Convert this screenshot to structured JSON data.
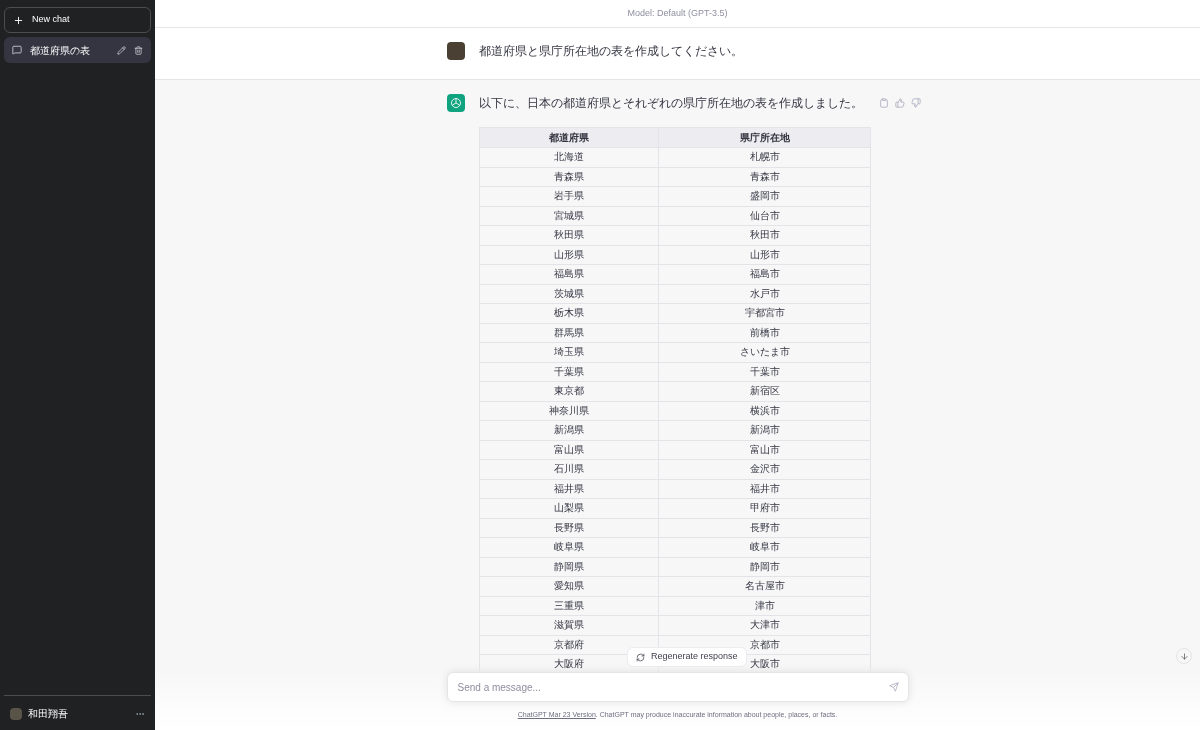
{
  "top_bar": {
    "title": "Model: Default (GPT-3.5)"
  },
  "sidebar": {
    "new_chat": "New chat",
    "conversations": [
      {
        "title": "都道府県の表",
        "selected": true
      }
    ],
    "user": {
      "name": "和田翔吾"
    }
  },
  "messages": [
    {
      "kind": "user",
      "text": "都道府県と県庁所在地の表を作成してください。"
    },
    {
      "kind": "assistant",
      "text": "以下に、日本の都道府県とそれぞれの県庁所在地の表を作成しました。",
      "table": {
        "columns": [
          "都道府県",
          "県庁所在地"
        ],
        "rows": [
          [
            "北海道",
            "札幌市"
          ],
          [
            "青森県",
            "青森市"
          ],
          [
            "岩手県",
            "盛岡市"
          ],
          [
            "宮城県",
            "仙台市"
          ],
          [
            "秋田県",
            "秋田市"
          ],
          [
            "山形県",
            "山形市"
          ],
          [
            "福島県",
            "福島市"
          ],
          [
            "茨城県",
            "水戸市"
          ],
          [
            "栃木県",
            "宇都宮市"
          ],
          [
            "群馬県",
            "前橋市"
          ],
          [
            "埼玉県",
            "さいたま市"
          ],
          [
            "千葉県",
            "千葉市"
          ],
          [
            "東京都",
            "新宿区"
          ],
          [
            "神奈川県",
            "横浜市"
          ],
          [
            "新潟県",
            "新潟市"
          ],
          [
            "富山県",
            "富山市"
          ],
          [
            "石川県",
            "金沢市"
          ],
          [
            "福井県",
            "福井市"
          ],
          [
            "山梨県",
            "甲府市"
          ],
          [
            "長野県",
            "長野市"
          ],
          [
            "岐阜県",
            "岐阜市"
          ],
          [
            "静岡県",
            "静岡市"
          ],
          [
            "愛知県",
            "名古屋市"
          ],
          [
            "三重県",
            "津市"
          ],
          [
            "滋賀県",
            "大津市"
          ],
          [
            "京都府",
            "京都市"
          ],
          [
            "大阪府",
            "大阪市"
          ]
        ]
      }
    }
  ],
  "regenerate": "Regenerate response",
  "composer": {
    "placeholder": "Send a message..."
  },
  "footer": {
    "link": "ChatGPT Mar 23 Version",
    "text": ". ChatGPT may produce inaccurate information about people, places, or facts."
  }
}
